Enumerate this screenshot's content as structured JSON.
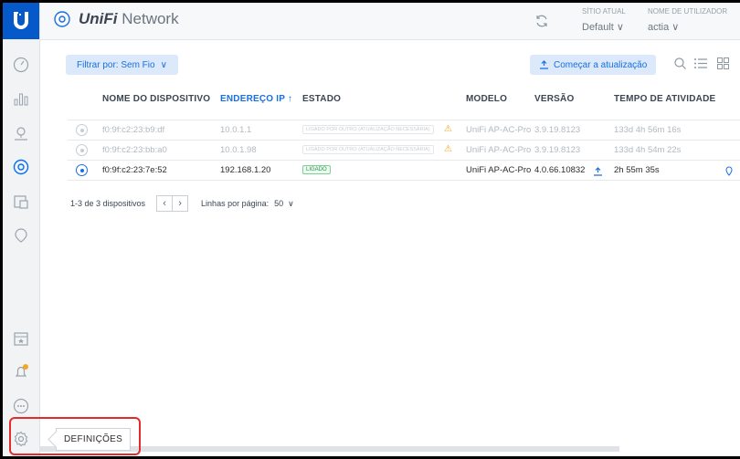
{
  "app": {
    "brand_prefix": "UniFi",
    "brand_suffix": "Network"
  },
  "header": {
    "site_label": "SÍTIO ATUAL",
    "site_value": "Default",
    "user_label": "NOME DE UTILIZADOR",
    "user_value": "actia"
  },
  "toolbar": {
    "filter_label": "Filtrar por: Sem Fio",
    "update_label": "Começar a atualização"
  },
  "table": {
    "columns": [
      "NOME DO DISPOSITIVO",
      "ENDEREÇO IP",
      "ESTADO",
      "MODELO",
      "VERSÃO",
      "TEMPO DE ATIVIDADE"
    ],
    "sort_indicator": "↑",
    "rows": [
      {
        "name": "f0:9f:c2:23:b9:df",
        "ip": "10.0.1.1",
        "state": "LIGADO POR OUTRO (ATUALIZAÇÃO NECESSÁRIA)",
        "model": "UniFi AP-AC-Pro",
        "version": "3.9.19.8123",
        "uptime": "133d 4h 56m 16s"
      },
      {
        "name": "f0:9f:c2:23:bb:a0",
        "ip": "10.0.1.98",
        "state": "LIGADO POR OUTRO (ATUALIZAÇÃO NECESSÁRIA)",
        "model": "UniFi AP-AC-Pro",
        "version": "3.9.19.8123",
        "uptime": "133d 4h 54m 22s"
      },
      {
        "name": "f0:9f:c2:23:7e:52",
        "ip": "192.168.1.20",
        "state": "LIGADO",
        "model": "UniFi AP-AC-Pro",
        "version": "4.0.66.10832",
        "uptime": "2h 55m 35s"
      }
    ]
  },
  "pagination": {
    "summary": "1-3 de 3 dispositivos",
    "rows_per_page_label": "Linhas por página:",
    "rows_per_page_value": "50"
  },
  "tooltip": {
    "label": "DEFINIÇÕES"
  },
  "colors": {
    "accent": "#1a6fe0",
    "logo_bg": "#0559c9",
    "highlight": "#e32b2b",
    "ok": "#1e9b45",
    "warning": "#f5a623"
  }
}
